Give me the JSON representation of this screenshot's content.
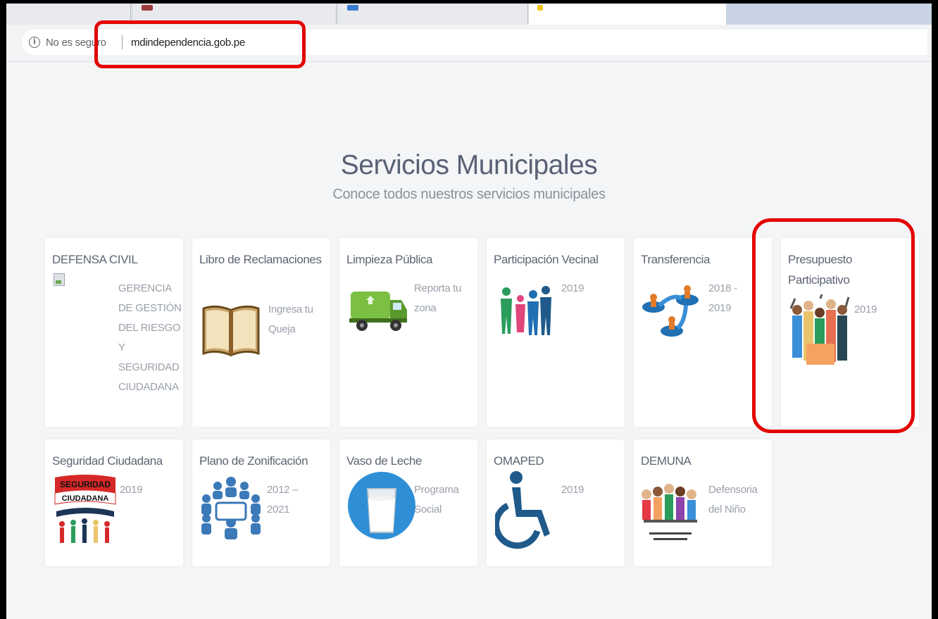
{
  "browser": {
    "security_label": "No es seguro",
    "url": "mdindependencia.gob.pe",
    "info_icon_glyph": "i"
  },
  "section": {
    "title": "Servicios Municipales",
    "subtitle": "Conoce todos nuestros servicios municipales"
  },
  "services": [
    {
      "title": "DEFENSA CIVIL",
      "desc": "GERENCIA DE GESTIÓN DEL RIESGO Y SEGURIDAD CIUDADANA",
      "icon": "broken-image-icon"
    },
    {
      "title": "Libro de Reclamaciones",
      "desc": "Ingresa tu Queja",
      "icon": "open-book-icon"
    },
    {
      "title": "Limpieza Pública",
      "desc": "Reporta tu zona",
      "icon": "garbage-truck-icon"
    },
    {
      "title": "Participación Vecinal",
      "desc": "2019",
      "icon": "community-people-icon"
    },
    {
      "title": "Transferencia",
      "desc": "2018 - 2019",
      "icon": "transfer-people-icon"
    },
    {
      "title": "Presupuesto Participativo",
      "desc": "2019",
      "icon": "crowd-people-icon"
    },
    {
      "title": "Seguridad Ciudadana",
      "desc": "2019",
      "icon": "seguridad-ciudadana-logo"
    },
    {
      "title": "Plano de Zonificación",
      "desc": "2012 – 2021",
      "icon": "meeting-table-icon"
    },
    {
      "title": "Vaso de Leche",
      "desc": "Programa Social",
      "icon": "milk-glass-icon"
    },
    {
      "title": "OMAPED",
      "desc": "2019",
      "icon": "wheelchair-icon"
    },
    {
      "title": "DEMUNA",
      "desc": "Defensoria del Niño",
      "icon": "children-group-icon"
    }
  ],
  "logo_texts": {
    "seguridad_line1": "SEGURIDAD",
    "seguridad_line2": "CIUDADANA"
  },
  "colors": {
    "annotation_red": "#e30000",
    "title_gray": "#596275",
    "page_bg": "#f4f5f7"
  }
}
